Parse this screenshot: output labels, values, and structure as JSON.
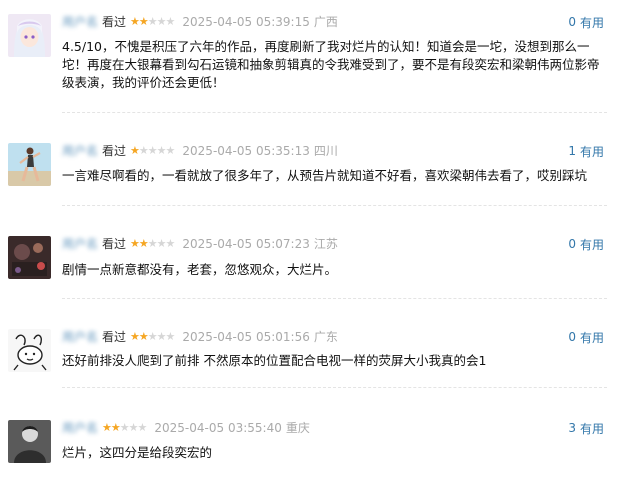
{
  "comments": [
    {
      "user": "用户名",
      "watched": "看过",
      "rating": 2,
      "time": "2025-04-05 05:39:15",
      "location": "广西",
      "vote_count": "0",
      "useful_label": "有用",
      "text": "4.5/10，不愧是积压了六年的作品，再度刷新了我对烂片的认知！知道会是一坨，没想到那么一坨！再度在大银幕看到勾石运镜和抽象剪辑真的令我难受到了，要不是有段奕宏和梁朝伟两位影帝级表演，我的评价还会更低！"
    },
    {
      "user": "用户名",
      "watched": "看过",
      "rating": 1,
      "time": "2025-04-05 05:35:13",
      "location": "四川",
      "vote_count": "1",
      "useful_label": "有用",
      "text": "一言难尽啊看的，一看就放了很多年了，从预告片就知道不好看，喜欢梁朝伟去看了，哎别踩坑"
    },
    {
      "user": "用户名",
      "watched": "看过",
      "rating": 2,
      "time": "2025-04-05 05:07:23",
      "location": "江苏",
      "vote_count": "0",
      "useful_label": "有用",
      "text": "剧情一点新意都没有，老套，忽悠观众，大烂片。"
    },
    {
      "user": "用户名",
      "watched": "看过",
      "rating": 2,
      "time": "2025-04-05 05:01:56",
      "location": "广东",
      "vote_count": "0",
      "useful_label": "有用",
      "text": "还好前排没人爬到了前排 不然原本的位置配合电视一样的荧屏大小我真的会1"
    },
    {
      "user": "用户名",
      "watched": "看过",
      "rating": 2,
      "time": "2025-04-05 03:55:40",
      "location": "重庆",
      "vote_count": "3",
      "useful_label": "有用",
      "text": "烂片，这四分是给段奕宏的"
    }
  ],
  "colors": {
    "link": "#3377aa",
    "star_on": "#f5a623",
    "star_off": "#d6d6d6",
    "meta_gray": "#aaaaaa"
  },
  "icons": {
    "star": "star-icon"
  }
}
